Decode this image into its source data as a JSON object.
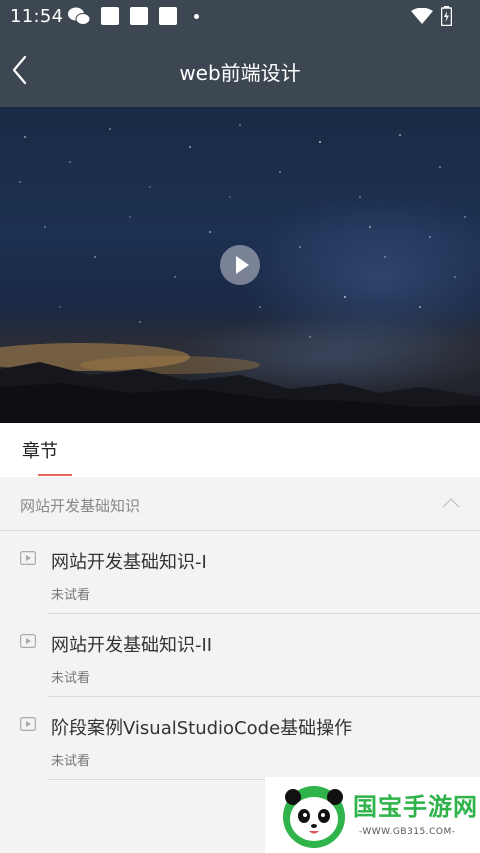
{
  "status_bar": {
    "time": "11:54",
    "icons": [
      "wechat-icon",
      "notification-square-icon",
      "notification-square-icon",
      "notification-square-icon",
      "dot-icon",
      "wifi-icon",
      "battery-charging-icon"
    ]
  },
  "header": {
    "title": "web前端设计",
    "back_icon": "chevron-left-icon"
  },
  "video": {
    "play_icon": "play-icon"
  },
  "tabs": [
    {
      "label": "章节",
      "active": true
    }
  ],
  "section": {
    "title": "网站开发基础知识",
    "expanded": true,
    "lessons": [
      {
        "title": "网站开发基础知识-I",
        "status": "未试看"
      },
      {
        "title": "网站开发基础知识-II",
        "status": "未试看"
      },
      {
        "title": "阶段案例VisualStudioCode基础操作",
        "status": "未试看"
      }
    ]
  },
  "watermark": {
    "brand": "国宝手游网",
    "url": "-WWW.GB315.COM-"
  },
  "colors": {
    "header_bg": "#3d4751",
    "tab_indicator": "#e66a5c",
    "watermark_green": "#2fb34a"
  }
}
